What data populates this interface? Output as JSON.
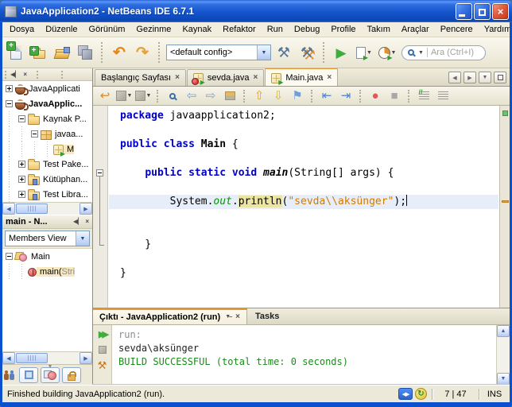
{
  "window": {
    "title": "JavaApplication2 - NetBeans IDE 6.7.1"
  },
  "menubar": [
    "Dosya",
    "Düzenle",
    "Görünüm",
    "Gezinme",
    "Kaynak",
    "Refaktor",
    "Run",
    "Debug",
    "Profile",
    "Takım",
    "Araçlar",
    "Pencere",
    "Yardım"
  ],
  "toolbar": {
    "file_icons": [
      "new-file",
      "new-project",
      "open-project",
      "save-all"
    ],
    "edit_icons": [
      "undo",
      "redo"
    ],
    "config_value": "<default config>",
    "build_icons": [
      "build",
      "clean-and-build"
    ],
    "run_icons": [
      "run",
      "debug",
      "profile"
    ],
    "search_placeholder": "Ara (Ctrl+I)"
  },
  "projects_panel": {
    "header_buttons": [
      "minimize-window-group",
      "close-window-group"
    ],
    "tree": [
      {
        "label": "JavaApplicati",
        "icon": "project",
        "toggle": "plus",
        "indent": 0
      },
      {
        "label": "JavaApplic...",
        "icon": "project",
        "toggle": "minus",
        "indent": 0,
        "bold": true
      },
      {
        "label": "Kaynak P...",
        "icon": "folder",
        "toggle": "minus",
        "indent": 1
      },
      {
        "label": "javaa...",
        "icon": "package",
        "toggle": "minus",
        "indent": 2
      },
      {
        "label": "M",
        "icon": "java-main-file",
        "toggle": null,
        "indent": 3,
        "selected": true
      },
      {
        "label": "Test Pake...",
        "icon": "folder",
        "toggle": "plus",
        "indent": 1
      },
      {
        "label": "Kütüphan...",
        "icon": "libraries",
        "toggle": "plus",
        "indent": 1
      },
      {
        "label": "Test Libra...",
        "icon": "libraries",
        "toggle": "plus",
        "indent": 1
      }
    ]
  },
  "navigator_panel": {
    "title": "main - N...",
    "view_value": "Members View",
    "tree": [
      {
        "label": "Main",
        "icon": "class",
        "toggle": "minus",
        "indent": 0
      },
      {
        "label": "main(",
        "label_muted": "Stri",
        "icon": "method",
        "toggle": null,
        "indent": 1,
        "selected": true
      }
    ],
    "filters": [
      "show-inherited-members",
      "show-fields",
      "show-static-members",
      "show-non-public-members"
    ]
  },
  "editor": {
    "tabs": [
      {
        "label": "Başlangıç Sayfası",
        "icon": null,
        "active": false
      },
      {
        "label": "sevda.java",
        "icon": "java-class-error",
        "active": false
      },
      {
        "label": "Main.java",
        "icon": "java-main-class",
        "active": true
      }
    ],
    "tab_controls": [
      "scroll-tabs-left",
      "scroll-tabs-right",
      "tab-list-dropdown",
      "maximize-window"
    ],
    "toolbar_icons": [
      "last-edit-location",
      "back",
      "forward",
      "|",
      "find-selection",
      "find-previous",
      "find-next",
      "toggle-highlight",
      "|",
      "previous-occurrence",
      "next-occurrence",
      "toggle-bookmark",
      "|",
      "shift-line-left",
      "shift-line-right",
      "|",
      "stop-macro-recording",
      "start-macro-recording",
      "|",
      "comment",
      "uncomment"
    ],
    "fold_start_line": 5,
    "fold_end_line": 10,
    "caret_line": 7,
    "code_lines": [
      {
        "tokens": [
          {
            "t": "package",
            "c": "kw"
          },
          {
            "t": " javaapplication2;",
            "c": "pl"
          }
        ]
      },
      {
        "tokens": []
      },
      {
        "tokens": [
          {
            "t": "public",
            "c": "kw"
          },
          {
            "t": " ",
            "c": "pl"
          },
          {
            "t": "class",
            "c": "kw"
          },
          {
            "t": " ",
            "c": "pl"
          },
          {
            "t": "Main",
            "c": "cls"
          },
          {
            "t": " {",
            "c": "pl"
          }
        ]
      },
      {
        "tokens": []
      },
      {
        "tokens": [
          {
            "t": "    ",
            "c": "pl"
          },
          {
            "t": "public",
            "c": "kw"
          },
          {
            "t": " ",
            "c": "pl"
          },
          {
            "t": "static",
            "c": "kw"
          },
          {
            "t": " ",
            "c": "pl"
          },
          {
            "t": "void",
            "c": "kw"
          },
          {
            "t": " ",
            "c": "pl"
          },
          {
            "t": "main",
            "c": "mth"
          },
          {
            "t": "(String[] args) {",
            "c": "pl"
          }
        ]
      },
      {
        "tokens": []
      },
      {
        "tokens": [
          {
            "t": "        System.",
            "c": "pl"
          },
          {
            "t": "out",
            "c": "fld"
          },
          {
            "t": ".",
            "c": "pl"
          },
          {
            "t": "println",
            "c": "occ"
          },
          {
            "t": "(",
            "c": "pl"
          },
          {
            "t": "\"sevda\\\\aksünger\"",
            "c": "str"
          },
          {
            "t": ");",
            "c": "pl"
          }
        ],
        "highlight": true,
        "caret": true
      },
      {
        "tokens": []
      },
      {
        "tokens": []
      },
      {
        "tokens": [
          {
            "t": "    }",
            "c": "pl"
          }
        ]
      },
      {
        "tokens": []
      },
      {
        "tokens": [
          {
            "t": "}",
            "c": "pl"
          }
        ]
      }
    ]
  },
  "output_panel": {
    "tab_label": "Çıktı - JavaApplication2 (run)",
    "tasks_label": "Tasks",
    "tab_buttons": [
      "output-dropdown",
      "close-output"
    ],
    "toolbar_icons": [
      "rerun",
      "stop",
      "ant-settings"
    ],
    "lines": [
      {
        "text": "run:",
        "c": "muted"
      },
      {
        "text": "sevda\\aksünger",
        "c": "plain"
      },
      {
        "text": "BUILD SUCCESSFUL (total time: 0 seconds)",
        "c": "success"
      }
    ]
  },
  "statusbar": {
    "message": "Finished building JavaApplication2 (run).",
    "caret_position": "7 | 47",
    "insert_mode": "INS"
  },
  "colors": {
    "keyword": "#0000c8",
    "string": "#ce7b00",
    "field": "#009900",
    "success": "#1a8c1a",
    "muted": "#8c8c8c",
    "selection": "#e7eef9",
    "occurrence": "#ece5a0",
    "tab_accent": "#e39a3b"
  }
}
